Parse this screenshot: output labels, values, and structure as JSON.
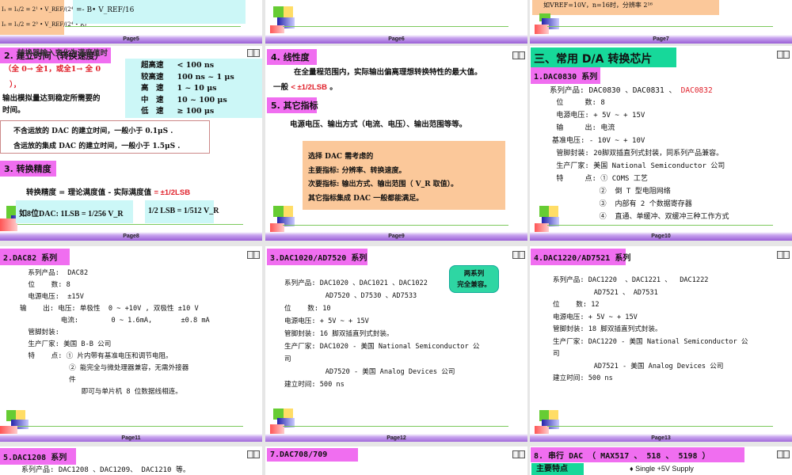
{
  "slide5": {
    "formula1": "I₁ = I₂/2 = 2¹ • V_REF/(2⁴ • R)",
    "formula0": "I₀ = I₁/2 = 2⁰ • V_REF/(2⁴ • R)",
    "result": "=- B• V_REF/16",
    "page": "Page5"
  },
  "slide6": {
    "page": "Page6"
  },
  "slide7": {
    "text": "如VREF=10V，n=16时，分辨率 2¹⁶",
    "page": "Page7"
  },
  "slide8": {
    "heading": "2. 建立时间（转换速度）",
    "overlay": "转换器输入变化为满度值时",
    "red1": "（全 0→ 全1，或全1→ 全 0",
    "red2": "），",
    "line3": "输出模拟量达到稳定所需要的",
    "line4": "时间。",
    "speed_table": [
      [
        "超高速",
        "< 100 ns"
      ],
      [
        "较高速",
        "100 ns ~ 1 μs"
      ],
      [
        "高　速",
        "1 ~ 10 μs"
      ],
      [
        "中　速",
        "10 ~ 100 μs"
      ],
      [
        "低　速",
        "≥ 100 μs"
      ]
    ],
    "note1": "不含运放的 DAC 的建立时间，一般小于 0.1μS .",
    "note2": "含运放的集成 DAC 的建立时间，一般小于 1.5μS .",
    "heading2": "3. 转换精度",
    "accuracy": "转换精度 = 理论满度值 - 实际满度值",
    "accuracy_val": "= ±1/2LSB",
    "f1": "如8位DAC: 1LSB = 1/256 V_R",
    "f2": "1/2 LSB = 1/512 V_R",
    "page": "Page8"
  },
  "slide9": {
    "heading": "4. 线性度",
    "l1": "在全量程范围内，实际输出偏离理想转换特性的最大值。",
    "l2a": "一般",
    "l2b": "< ±1/2LSB",
    "l2c": " 。",
    "heading2": "5. 其它指标",
    "l3": "电源电压、输出方式（电流、电压）、输出范围等等。",
    "box": [
      "选择 DAC 需考虑的",
      " 主要指标: 分辨率、转换速度。",
      " 次要指标: 输出方式、输出范围（ V_R 取值）。",
      "其它指标集成 DAC 一般都能满足。"
    ],
    "page": "Page9"
  },
  "slide10": {
    "title": "三、常用 D/A 转换芯片",
    "heading": "1.DAC0830 系列",
    "products_label": "系列产品:  DAC0830 、DAC0831 、 ",
    "products_red": "DAC0832",
    "lines": [
      " 位     数: 8",
      " 电源电压: + 5V ~ + 15V",
      " 输     出: 电流",
      "基准电压: - 10V ~ + 10V",
      " 管脚封装: 20脚双插直列式封装，同系列产品兼容。",
      " 生产厂家: 美国 National Semiconductor 公司",
      " 特     点: ① COMS 工艺",
      "           ②  倒 T 型电阻网络",
      "           ③  内部有 2 个数据寄存器",
      "           ④  直通、单缓冲、双缓冲三种工作方式"
    ],
    "page": "Page10"
  },
  "slide11": {
    "heading": "2.DAC82 系列",
    "lines": [
      "  系列产品:  DAC82",
      "  位    数: 8",
      "  电源电压:  ±15V",
      "输    出: 电压: 单极性  0 ~ +10V , 双极性 ±10 V",
      "          电流:        0 ~ 1.6mA,       ±0.8 mA",
      "  管脚封装:",
      "  生产厂家: 美国 B-B 公司",
      "  特    点: ① 片内带有基准电压和调节电阻。",
      "            ② 能完全与微处理器兼容，无需外接器",
      "            件",
      "               即可与单片机 8 位数据线相连。"
    ],
    "page": "Page11"
  },
  "slide12": {
    "heading": "3.DAC1020/AD7520 系列",
    "callout": [
      "两系列",
      "完全兼容。"
    ],
    "lines": [
      "系列产品: DAC1020 、DAC1021 、DAC1022",
      "          AD7520 、D7530 、AD7533",
      "位    数: 10",
      "电源电压: + 5V ~ + 15V",
      "管脚封装: 16 脚双插直列式封装。",
      "生产厂家: DAC1020 - 美国 National Semiconductor 公",
      "司",
      "          AD7520 - 美国 Analog Devices 公司",
      "建立时间: 500 ns"
    ],
    "page": "Page12"
  },
  "slide13": {
    "heading": "4.DAC1220/AD7521 系列",
    "lines": [
      "系列产品: DAC1220  、DAC1221 、  DAC1222",
      "          AD7521 、 AD7531",
      "位    数: 12",
      "电源电压: + 5V ~ + 15V",
      "管脚封装: 18 脚双插直列式封装。",
      "生产厂家: DAC1220 - 美国 National Semiconductor 公",
      "司",
      "          AD7521 - 美国 Analog Devices 公司",
      "建立时间: 500 ns"
    ],
    "page": "Page13"
  },
  "slide14": {
    "heading": "5.DAC1208  系列",
    "line": "系列产品:  DAC1208 、DAC1209、  DAC1210 等。"
  },
  "slide15": {
    "heading": "7.DAC708/709"
  },
  "slide16": {
    "heading": "8. 串行 DAC （ MAX517 、 518 、 5198 ）",
    "feature": "主要特点",
    "bullet": "♦ Single +5V Supply"
  }
}
